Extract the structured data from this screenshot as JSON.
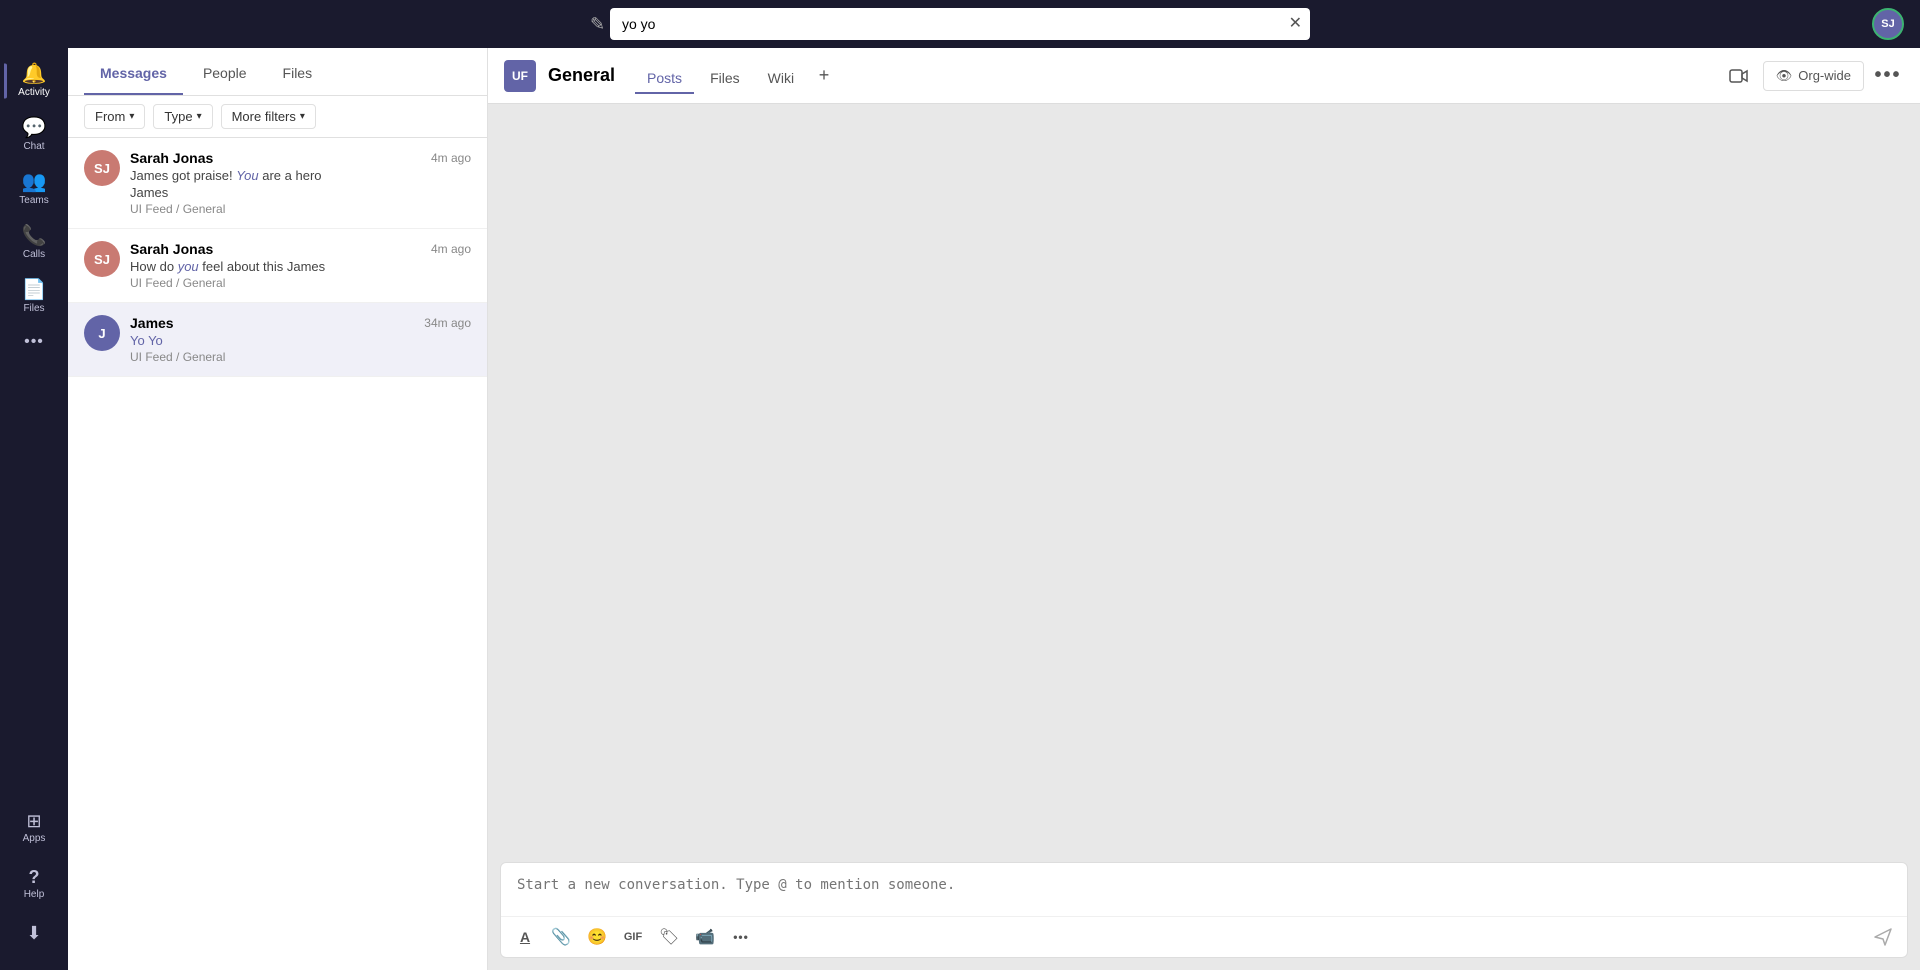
{
  "topbar": {
    "search_value": "yo yo",
    "new_chat_icon": "✎",
    "clear_icon": "✕",
    "user_initials": "SJ"
  },
  "sidebar": {
    "items": [
      {
        "id": "activity",
        "label": "Activity",
        "icon": "🔔",
        "active": false
      },
      {
        "id": "chat",
        "label": "Chat",
        "icon": "💬",
        "active": true
      },
      {
        "id": "teams",
        "label": "Teams",
        "icon": "👥",
        "active": false
      },
      {
        "id": "calls",
        "label": "Calls",
        "icon": "📞",
        "active": false
      },
      {
        "id": "files",
        "label": "Files",
        "icon": "📄",
        "active": false
      },
      {
        "id": "more",
        "label": "...",
        "icon": "···",
        "active": false
      }
    ],
    "bottom_items": [
      {
        "id": "apps",
        "label": "Apps",
        "icon": "⊞"
      },
      {
        "id": "help",
        "label": "Help",
        "icon": "?"
      },
      {
        "id": "download",
        "label": "Download",
        "icon": "⬇"
      }
    ]
  },
  "search_panel": {
    "tabs": [
      {
        "id": "messages",
        "label": "Messages",
        "active": true
      },
      {
        "id": "people",
        "label": "People",
        "active": false
      },
      {
        "id": "files",
        "label": "Files",
        "active": false
      }
    ],
    "filters": [
      {
        "id": "from",
        "label": "From"
      },
      {
        "id": "type",
        "label": "Type"
      },
      {
        "id": "more",
        "label": "More filters"
      }
    ],
    "results": [
      {
        "id": "result-1",
        "avatar_initials": "SJ",
        "avatar_class": "avatar-sj",
        "name": "Sarah Jonas",
        "time": "4m ago",
        "message_parts": [
          {
            "text": "James got praise! ",
            "highlighted": false
          },
          {
            "text": "You",
            "highlighted": true
          },
          {
            "text": " are a hero",
            "highlighted": false
          }
        ],
        "message_line2": "James",
        "channel": "UI Feed / General",
        "selected": false
      },
      {
        "id": "result-2",
        "avatar_initials": "SJ",
        "avatar_class": "avatar-sj",
        "name": "Sarah Jonas",
        "time": "4m ago",
        "message": "How do you feel about this James",
        "channel": "UI Feed / General",
        "selected": false
      },
      {
        "id": "result-3",
        "avatar_initials": "J",
        "avatar_class": "avatar-j",
        "name": "James",
        "time": "34m ago",
        "message_yo": "Yo Yo",
        "channel": "UI Feed / General",
        "selected": true
      }
    ]
  },
  "channel": {
    "badge": "UF",
    "name": "General",
    "tabs": [
      {
        "id": "posts",
        "label": "Posts",
        "active": true
      },
      {
        "id": "files",
        "label": "Files",
        "active": false
      },
      {
        "id": "wiki",
        "label": "Wiki",
        "active": false
      }
    ],
    "org_wide_label": "Org-wide"
  },
  "composer": {
    "placeholder": "Start a new conversation. Type @ to mention someone.",
    "toolbar_icons": [
      {
        "id": "format",
        "icon": "A̲"
      },
      {
        "id": "attach",
        "icon": "📎"
      },
      {
        "id": "emoji",
        "icon": "😊"
      },
      {
        "id": "gif",
        "icon": "GIF"
      },
      {
        "id": "sticker",
        "icon": "🏷"
      },
      {
        "id": "video",
        "icon": "📹"
      },
      {
        "id": "more",
        "icon": "···"
      }
    ]
  }
}
